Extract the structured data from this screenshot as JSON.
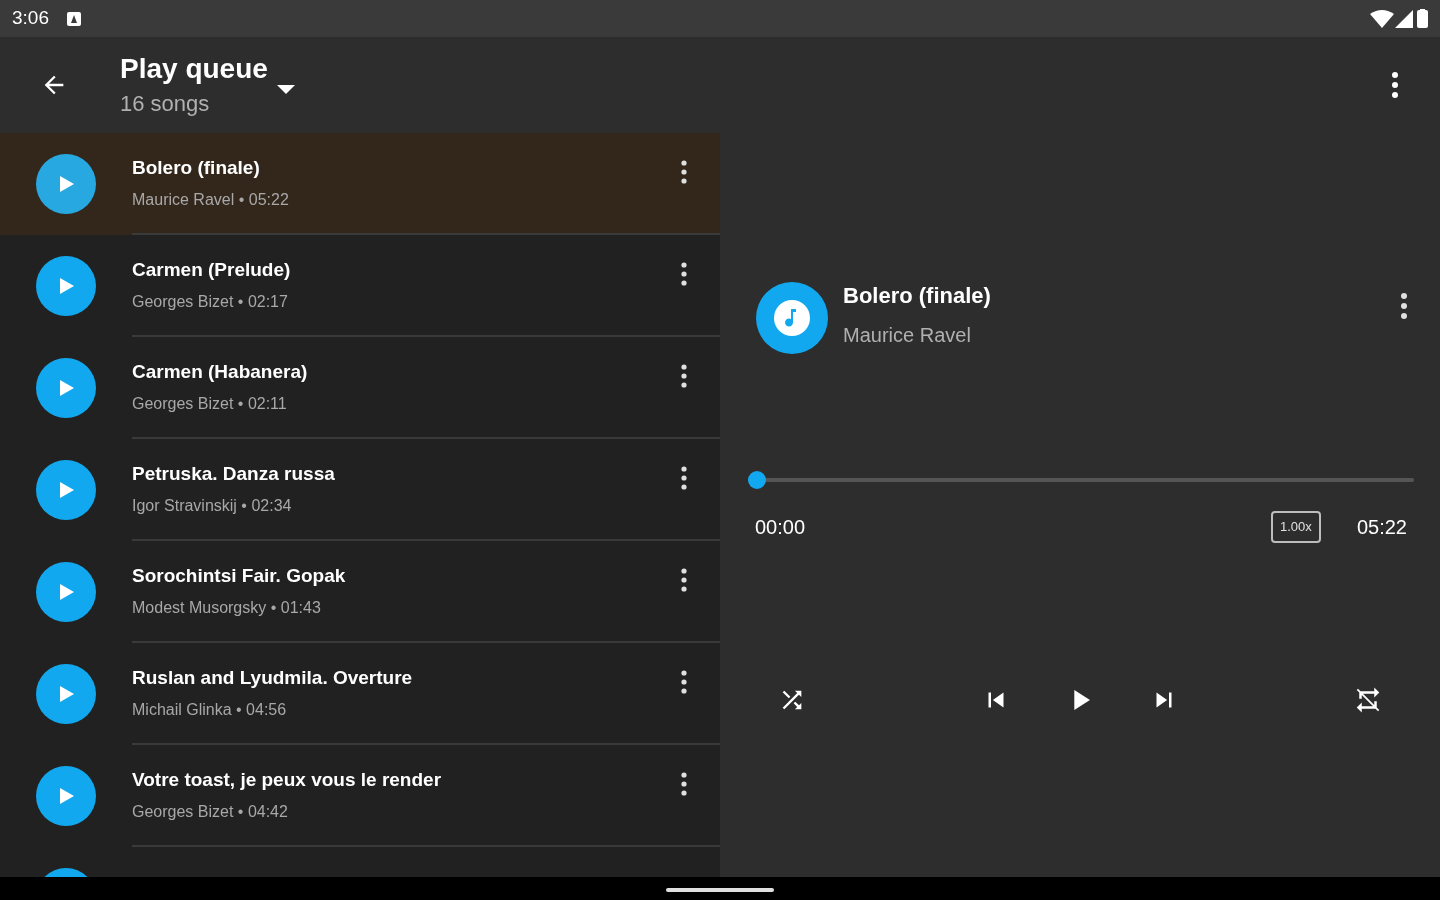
{
  "status_bar": {
    "time": "3:06"
  },
  "app_bar": {
    "title": "Play queue",
    "subtitle": "16 songs"
  },
  "queue": [
    {
      "title": "Bolero (finale)",
      "subtitle": "Maurice Ravel • 05:22",
      "selected": true
    },
    {
      "title": "Carmen (Prelude)",
      "subtitle": "Georges Bizet • 02:17",
      "selected": false
    },
    {
      "title": "Carmen (Habanera)",
      "subtitle": "Georges Bizet • 02:11",
      "selected": false
    },
    {
      "title": "Petruska. Danza russa",
      "subtitle": "Igor Stravinskij • 02:34",
      "selected": false
    },
    {
      "title": "Sorochintsi Fair. Gopak",
      "subtitle": "Modest Musorgsky • 01:43",
      "selected": false
    },
    {
      "title": "Ruslan and Lyudmila. Overture",
      "subtitle": "Michail Glinka • 04:56",
      "selected": false
    },
    {
      "title": "Votre toast, je peux vous le render",
      "subtitle": "Georges Bizet • 04:42",
      "selected": false
    },
    {
      "selected": false
    }
  ],
  "now_playing": {
    "title": "Bolero (finale)",
    "artist": "Maurice Ravel",
    "level": 0.0,
    "elapsed": "00:00",
    "speed": "1.00x",
    "duration": "05:22"
  }
}
